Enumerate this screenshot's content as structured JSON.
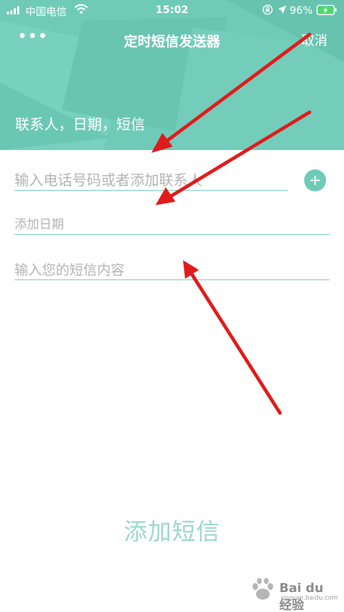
{
  "status_bar": {
    "carrier": "中国电信",
    "time": "15:02",
    "battery_percent": "96%"
  },
  "navbar": {
    "more_label": "•••",
    "title": "定时短信发送器",
    "cancel_label": "取消"
  },
  "header": {
    "subtitle": "联系人，日期，短信"
  },
  "form": {
    "phone_placeholder": "输入电话号码或者添加联系人",
    "date_placeholder": "添加日期",
    "message_placeholder": "输入您的短信内容"
  },
  "actions": {
    "add_sms_label": "添加短信"
  },
  "watermark": {
    "text": "Bai du 经验",
    "sub": "jingyan.baidu.com"
  },
  "colors": {
    "accent": "#6fcbb8",
    "annotation_arrow": "#e01b1b"
  },
  "icons": {
    "add_contact": "plus-circle-icon",
    "more": "more-dots-icon"
  }
}
